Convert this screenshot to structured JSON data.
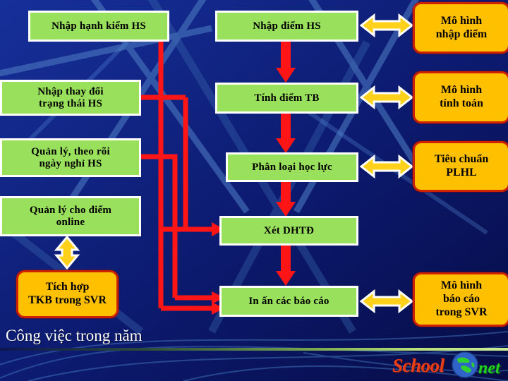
{
  "slide": {
    "footer_title": "Công việc trong năm",
    "logo": {
      "word1": "School",
      "word2": "net",
      "globe_icon": "globe-icon"
    },
    "colors": {
      "background_blue": "#0c1a6e",
      "green_box": "#99e05c",
      "yellow_box": "#ffc000",
      "yellow_box_border": "#cc2200",
      "red_connector": "#ff1a1a",
      "arrow_yellow": "#ffd11a",
      "arrow_outline": "#ffffff",
      "text_dark": "#000000",
      "text_white": "#ffffff"
    }
  },
  "left_column": {
    "boxes": [
      {
        "id": "nhap-hanh-kiem",
        "label": "Nhập hạnh kiểm HS"
      },
      {
        "id": "nhap-thay-doi-trang-thai",
        "label": "Nhập thay đổi\ntrạng thái HS"
      },
      {
        "id": "quan-ly-theo-roi-ngay-nghi",
        "label": "Quản lý, theo rõi\nngày nghỉ HS"
      },
      {
        "id": "quan-ly-cho-diem-online",
        "label": "Quản lý cho điểm\nonline"
      }
    ],
    "yellow_box": {
      "id": "tich-hop-tkb",
      "label": "Tích hợp\nTKB trong SVR"
    }
  },
  "middle_column": {
    "boxes": [
      {
        "id": "nhap-diem-hs",
        "label": "Nhập điểm HS"
      },
      {
        "id": "tinh-diem-tb",
        "label": "Tính điểm TB"
      },
      {
        "id": "phan-loai-hoc-luc",
        "label": "Phân loại học lực"
      },
      {
        "id": "xet-dhtd",
        "label": "Xét DHTĐ"
      },
      {
        "id": "in-an-cac-bao-cao",
        "label": "In ấn các báo cáo"
      }
    ]
  },
  "right_column": {
    "boxes": [
      {
        "id": "mo-hinh-nhap-diem",
        "label": "Mô hình\nnhập điểm"
      },
      {
        "id": "mo-hinh-tinh-toan",
        "label": "Mô hình\ntính toán"
      },
      {
        "id": "tieu-chuan-plhl",
        "label": "Tiêu chuẩn\nPLHL"
      },
      {
        "id": "mo-hinh-bao-cao-trong-svr",
        "label": "Mô hình\nbáo cáo\ntrong SVR"
      }
    ]
  },
  "connectors": {
    "bidirectional_arrows": 5,
    "flow_arrows": 7
  }
}
